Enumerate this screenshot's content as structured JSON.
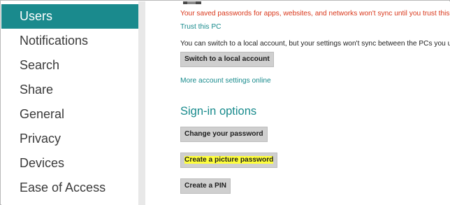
{
  "sidebar": {
    "items": [
      {
        "label": "Users",
        "selected": true
      },
      {
        "label": "Notifications"
      },
      {
        "label": "Search"
      },
      {
        "label": "Share"
      },
      {
        "label": "General"
      },
      {
        "label": "Privacy"
      },
      {
        "label": "Devices"
      },
      {
        "label": "Ease of Access"
      }
    ]
  },
  "account": {
    "warning_text": "Your saved passwords for apps, websites, and networks won't sync until you trust this PC.",
    "trust_link": "Trust this PC",
    "local_info": "You can switch to a local account, but your settings won't sync between the PCs you use.",
    "switch_button": "Switch to a local account",
    "more_settings_link": "More account settings online"
  },
  "signin": {
    "heading": "Sign-in options",
    "change_password_button": "Change your password",
    "picture_password_button": "Create a picture password",
    "pin_button": "Create a PIN"
  },
  "colors": {
    "accent": "#1a8a8d",
    "warning": "#d9371b",
    "highlight": "#ffff3b",
    "button_bg": "#cfcfcf"
  }
}
